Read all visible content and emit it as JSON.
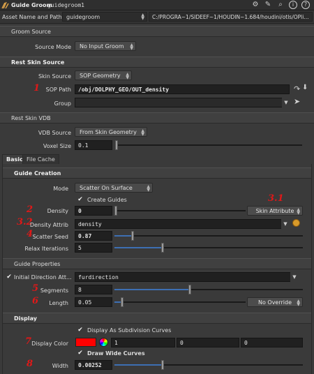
{
  "header": {
    "node_type": "Guide Groom",
    "node_name": "guidegroom1",
    "icons": [
      "gear-icon",
      "wrench-icon",
      "search-icon",
      "info-icon",
      "help-icon"
    ]
  },
  "asset": {
    "label": "Asset Name and Path",
    "name": "guidegroom",
    "path": "C:/PROGRA~1/SIDEEF~1/HOUDIN~1.684/houdini/otls/OPli..."
  },
  "groom_source": {
    "title": "Groom Source",
    "source_mode_label": "Source Mode",
    "source_mode_value": "No Input Groom"
  },
  "rest_skin_source": {
    "title": "Rest Skin Source",
    "skin_source_label": "Skin Source",
    "skin_source_value": "SOP Geometry",
    "sop_path_label": "SOP Path",
    "sop_path_value": "/obj/DOLPHY_GEO/OUT_density",
    "group_label": "Group",
    "group_value": ""
  },
  "rest_skin_vdb": {
    "title": "Rest Skin VDB",
    "vdb_source_label": "VDB Source",
    "vdb_source_value": "From Skin Geometry",
    "voxel_size_label": "Voxel Size",
    "voxel_size_value": "0.1",
    "voxel_size_level": 0.0
  },
  "tabs": [
    {
      "label": "Basic",
      "active": true
    },
    {
      "label": "File Cache",
      "active": false
    }
  ],
  "guide_creation": {
    "title": "Guide Creation",
    "mode_label": "Mode",
    "mode_value": "Scatter On Surface",
    "create_guides_label": "Create Guides",
    "create_guides_checked": true,
    "density_label": "Density",
    "density_value": "0",
    "density_level": 0.0,
    "density_button": "Skin Attribute",
    "density_attrib_label": "Density Attrib",
    "density_attrib_value": "density",
    "scatter_seed_label": "Scatter Seed",
    "scatter_seed_value": "0.87",
    "scatter_seed_level": 0.09,
    "relax_label": "Relax Iterations",
    "relax_value": "5",
    "relax_level": 0.25
  },
  "guide_properties": {
    "title": "Guide Properties",
    "init_dir_label": "Initial Direction Att...",
    "init_dir_checked": true,
    "init_dir_value": "furdirection",
    "segments_label": "Segments",
    "segments_value": "8",
    "segments_level": 0.4,
    "length_label": "Length",
    "length_value": "0.05",
    "length_level": 0.05,
    "length_mode": "No Override"
  },
  "display": {
    "title": "Display",
    "subdiv_label": "Display As Subdivision Curves",
    "subdiv_checked": true,
    "color_label": "Display Color",
    "color_hex": "#ff0000",
    "color_r": "1",
    "color_g": "0",
    "color_b": "0",
    "wide_label": "Draw Wide Curves",
    "wide_checked": true,
    "width_label": "Width",
    "width_value": "0.00252",
    "width_level": 0.25
  },
  "markers": {
    "m1": "1",
    "m2": "2",
    "m31": "3.1",
    "m32": "3.2",
    "m4": "4",
    "m5": "5",
    "m6": "6",
    "m7": "7",
    "m8": "8"
  },
  "colors": {
    "marker_red": "#e01818",
    "slider_fill": "#3d6fb3",
    "panel_bg": "#3a3a3a"
  }
}
